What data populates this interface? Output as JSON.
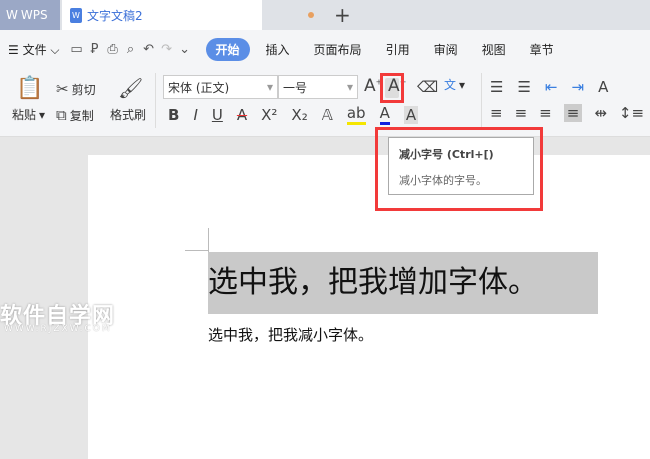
{
  "tabs": {
    "app": "WPS",
    "document": "文字文稿2",
    "new_tab": "+"
  },
  "menu": {
    "file": "文件",
    "items": [
      "开始",
      "插入",
      "页面布局",
      "引用",
      "审阅",
      "视图",
      "章节"
    ]
  },
  "clipboard": {
    "paste": "粘贴",
    "cut": "剪切",
    "copy": "复制",
    "format_painter": "格式刷"
  },
  "font": {
    "name": "宋体 (正文)",
    "size": "一号"
  },
  "tooltip": {
    "title": "减小字号 (Ctrl+[)",
    "desc": "减小字体的字号。"
  },
  "document": {
    "line1": "选中我，把我增加字体。",
    "line2": "选中我，把我减小字体。"
  },
  "watermark": {
    "text": "软件自学网",
    "url": "WWW.RJZXW.COM"
  },
  "colors": {
    "accent": "#5b8ee6",
    "highlight": "#f23a3a"
  }
}
